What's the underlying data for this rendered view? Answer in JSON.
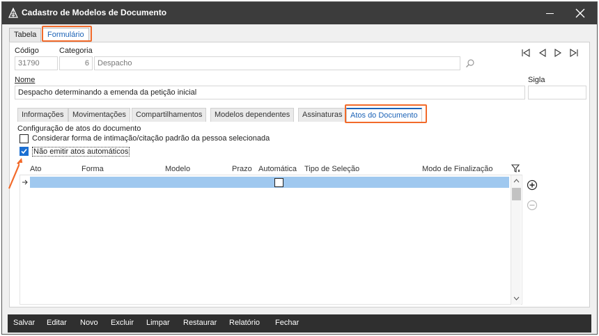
{
  "window": {
    "title": "Cadastro de Modelos de Documento",
    "icons": {
      "app": "scales-icon",
      "minimize": "minimize-icon",
      "close": "close-icon"
    }
  },
  "main_tabs": [
    {
      "label": "Tabela",
      "active": false
    },
    {
      "label": "Formulário",
      "active": true
    }
  ],
  "form": {
    "codigo": {
      "label": "Código",
      "value": "31790"
    },
    "categoria": {
      "label": "Categoria",
      "number": "6",
      "name": "Despacho"
    },
    "nome": {
      "label": "Nome",
      "value": "Despacho determinando a emenda da petição inicial"
    },
    "sigla": {
      "label": "Sigla",
      "value": ""
    }
  },
  "record_nav": [
    "first-record-icon",
    "previous-record-icon",
    "next-record-icon",
    "last-record-icon"
  ],
  "sub_tabs": [
    {
      "label": "Informações",
      "active": false
    },
    {
      "label": "Movimentações",
      "active": false
    },
    {
      "label": "Compartilhamentos",
      "active": false
    },
    {
      "label": "Modelos dependentes",
      "active": false
    },
    {
      "label": "Assinaturas",
      "active": false
    },
    {
      "label": "Atos do Documento",
      "active": true
    }
  ],
  "atos": {
    "section_title": "Configuração de atos do documento",
    "option_considerar": {
      "label": "Considerar forma de intimação/citação padrão da pessoa selecionada",
      "checked": false
    },
    "option_nao_emitir": {
      "label": "Não emitir atos automáticos",
      "checked": true
    },
    "columns": [
      "Ato",
      "Forma",
      "Modelo",
      "Prazo",
      "Automática",
      "Tipo de Seleção",
      "Modo de Finalização"
    ],
    "rows": [
      {
        "ato": "",
        "forma": "",
        "modelo": "",
        "prazo": "",
        "automatica": false,
        "tipo_selecao": "",
        "modo_finalizacao": "",
        "selected": true
      }
    ]
  },
  "actions": [
    "Salvar",
    "Editar",
    "Novo",
    "Excluir",
    "Limpar",
    "Restaurar",
    "Relatório",
    "Fechar"
  ],
  "colors": {
    "accent": "#1c63b7",
    "highlight": "#f26a2a",
    "selected_row": "#9fc8ef",
    "titlebar": "#3c3c3c"
  }
}
